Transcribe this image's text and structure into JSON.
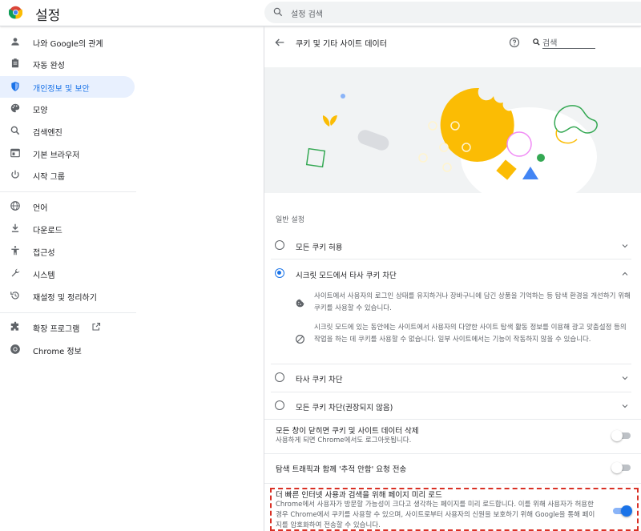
{
  "app": {
    "title": "설정"
  },
  "search": {
    "placeholder": "설정 검색"
  },
  "sidebar": {
    "items": [
      {
        "label": "나와 Google의 관계",
        "icon": "person-icon"
      },
      {
        "label": "자동 완성",
        "icon": "clipboard-icon"
      },
      {
        "label": "개인정보 및 보안",
        "icon": "shield-icon"
      },
      {
        "label": "모양",
        "icon": "palette-icon"
      },
      {
        "label": "검색엔진",
        "icon": "search-icon"
      },
      {
        "label": "기본 브라우저",
        "icon": "browser-icon"
      },
      {
        "label": "시작 그룹",
        "icon": "power-icon"
      },
      {
        "label": "언어",
        "icon": "globe-icon"
      },
      {
        "label": "다운로드",
        "icon": "download-icon"
      },
      {
        "label": "접근성",
        "icon": "accessibility-icon"
      },
      {
        "label": "시스템",
        "icon": "wrench-icon"
      },
      {
        "label": "재설정 및 정리하기",
        "icon": "restore-icon"
      },
      {
        "label": "확장 프로그램",
        "icon": "puzzle-icon"
      },
      {
        "label": "Chrome 정보",
        "icon": "chrome-icon"
      }
    ]
  },
  "panel": {
    "title": "쿠키 및 기타 사이트 데이터",
    "search_label": "검색",
    "general_title": "일반 설정",
    "options": [
      {
        "label": "모든 쿠키 허용",
        "selected": false
      },
      {
        "label": "시크릿 모드에서 타사 쿠키 차단",
        "selected": true
      },
      {
        "label": "타사 쿠키 차단",
        "selected": false
      },
      {
        "label": "모든 쿠키 차단(권장되지 않음)",
        "selected": false
      }
    ],
    "details": [
      "사이트에서 사용자의 로그인 상태를 유지하거나 장바구니에 담긴 상품을 기억하는 등 탐색 환경을 개선하기 위해 쿠키를 사용할 수 있습니다.",
      "시크릿 모드에 있는 동안에는 사이트에서 사용자의 다양한 사이트 탐색 활동 정보를 이용해 광고 맞춤설정 등의 작업을 하는 데 쿠키를 사용할 수 없습니다. 일부 사이트에서는 기능이 작동하지 않을 수 있습니다."
    ],
    "toggles": [
      {
        "title": "모든 창이 닫히면 쿠키 및 사이트 데이터 삭제",
        "desc": "사용하게 되면 Chrome에서도 로그아웃됩니다.",
        "on": false
      },
      {
        "title": "탐색 트래픽과 함께 '추적 안함' 요청 전송",
        "desc": "",
        "on": false
      },
      {
        "title": "더 빠른 인터넷 사용과 검색을 위해 페이지 미리 로드",
        "desc": "Chrome에서 사용자가 방문할 가능성이 크다고 생각하는 페이지를 미리 로드합니다. 이를 위해 사용자가 허용한 경우 Chrome에서 쿠키를 사용할 수 있으며, 사이트로부터 사용자의 신원을 보호하기 위해 Google을 통해 페이지를 암호화하여 전송할 수 있습니다.",
        "on": true
      }
    ]
  },
  "colors": {
    "accent": "#1a73e8",
    "cookie": "#fbbc04",
    "highlight": "#d93025"
  }
}
